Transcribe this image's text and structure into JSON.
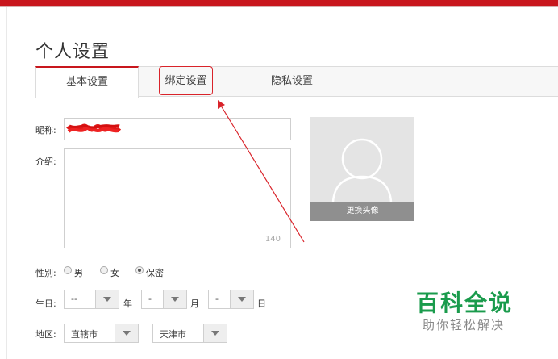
{
  "page_title": "个人设置",
  "tabs": [
    {
      "label": "基本设置",
      "active": true
    },
    {
      "label": "绑定设置",
      "active": false,
      "highlighted": true
    },
    {
      "label": "隐私设置",
      "active": false
    }
  ],
  "form": {
    "nickname_label": "昵称:",
    "intro_label": "介绍:",
    "intro_counter": "140",
    "avatar_button": "更换头像",
    "gender_label": "性别:",
    "gender_options": [
      {
        "label": "男",
        "checked": false
      },
      {
        "label": "女",
        "checked": false
      },
      {
        "label": "保密",
        "checked": true
      }
    ],
    "birthday_label": "生日:",
    "birthday_year": "--",
    "birthday_year_unit": "年",
    "birthday_month": "-",
    "birthday_month_unit": "月",
    "birthday_day": "-",
    "birthday_day_unit": "日",
    "region_label": "地区:",
    "region_province": "直辖市",
    "region_city": "天津市"
  },
  "watermark": {
    "main": "百科全说",
    "sub": "助你轻松解决"
  },
  "colors": {
    "accent": "#c8161d",
    "annotation": "#d9232a",
    "watermark": "#1a9b4c"
  }
}
